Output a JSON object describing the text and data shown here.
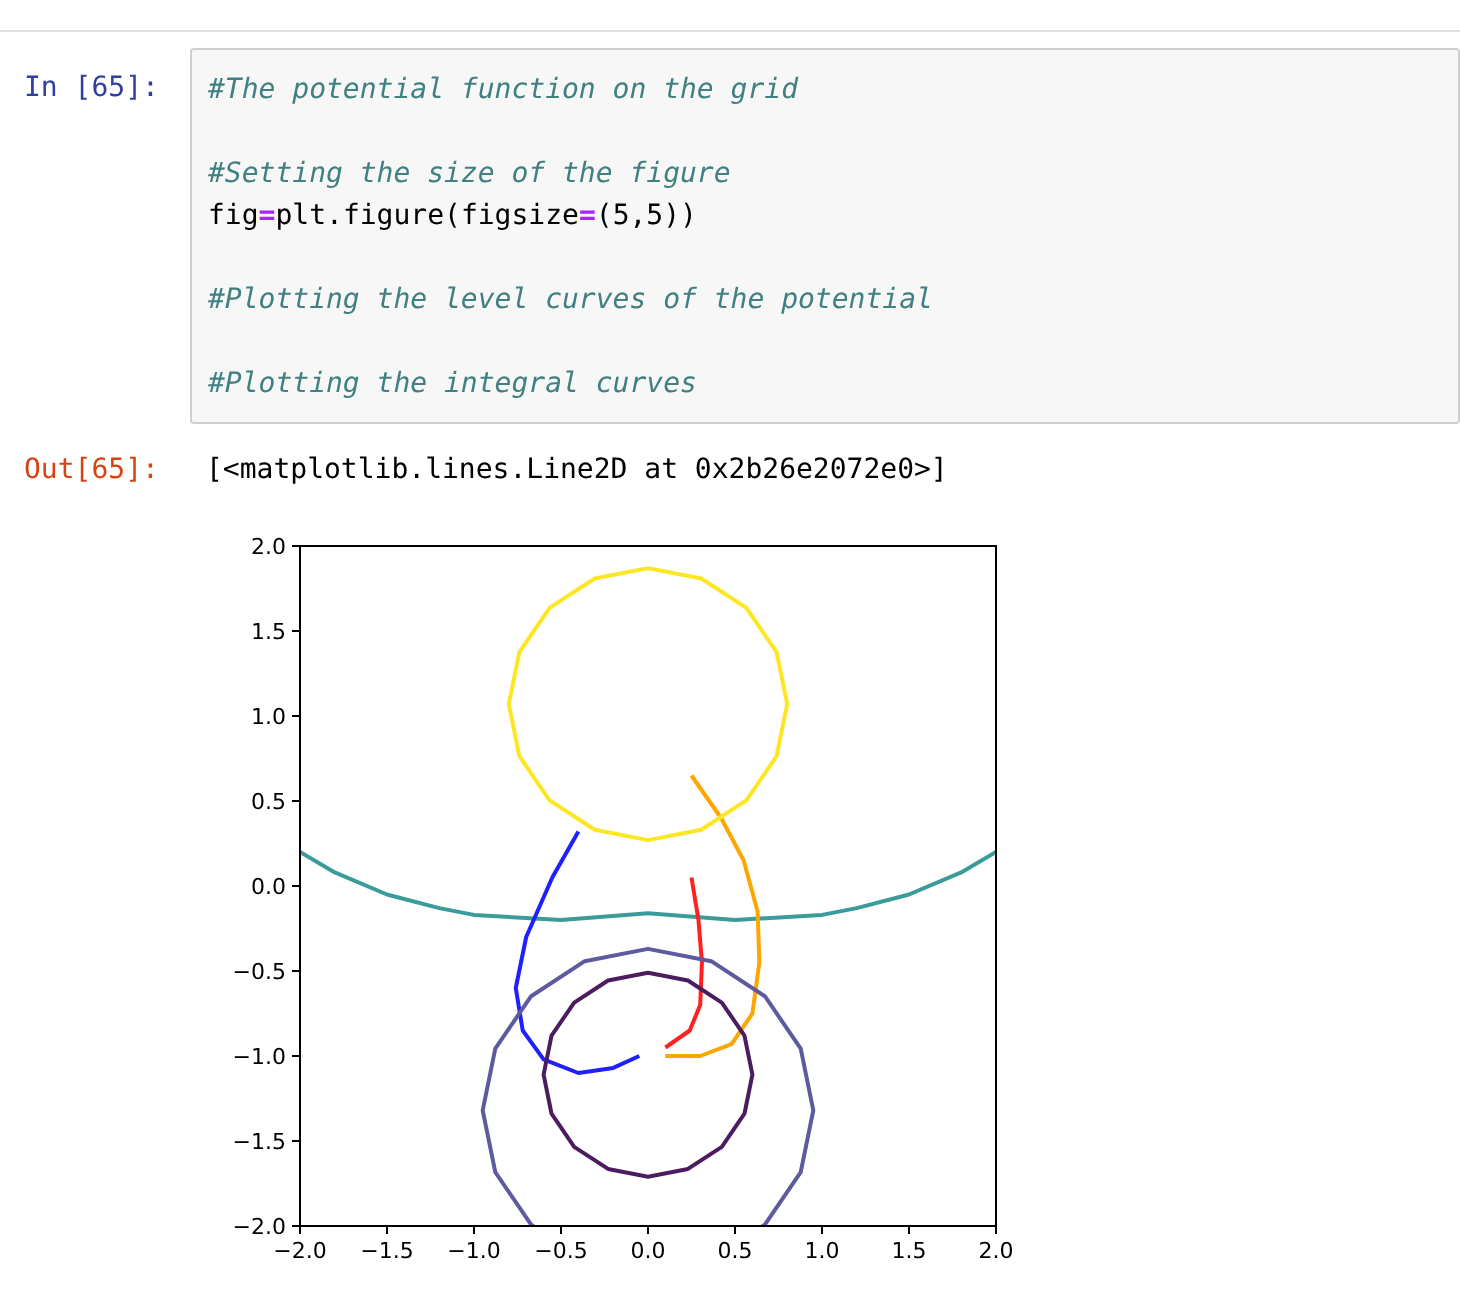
{
  "input_cell": {
    "prompt": "In [65]:",
    "lines": [
      {
        "kind": "comment",
        "text": "#The potential function on the grid"
      },
      {
        "kind": "blank"
      },
      {
        "kind": "comment",
        "text": "#Setting the size of the figure"
      },
      {
        "kind": "code",
        "tokens": [
          {
            "kind": "name",
            "text": "fig"
          },
          {
            "kind": "operator",
            "text": "="
          },
          {
            "kind": "name",
            "text": "plt.figure(figsize"
          },
          {
            "kind": "operator",
            "text": "="
          },
          {
            "kind": "name",
            "text": "(5,5))"
          }
        ]
      },
      {
        "kind": "blank"
      },
      {
        "kind": "comment",
        "text": "#Plotting the level curves of the potential"
      },
      {
        "kind": "blank"
      },
      {
        "kind": "comment",
        "text": "#Plotting the integral curves"
      }
    ]
  },
  "output_cell": {
    "prompt": "Out[65]:",
    "text": "[<matplotlib.lines.Line2D at 0x2b26e2072e0>]",
    "chart_data": {
      "type": "line",
      "xlim": [
        -2,
        2
      ],
      "ylim": [
        -2,
        2
      ],
      "xticks": [
        {
          "value": -2,
          "label": "−2.0"
        },
        {
          "value": -1.5,
          "label": "−1.5"
        },
        {
          "value": -1,
          "label": "−1.0"
        },
        {
          "value": -0.5,
          "label": "−0.5"
        },
        {
          "value": 0,
          "label": "0.0"
        },
        {
          "value": 0.5,
          "label": "0.5"
        },
        {
          "value": 1,
          "label": "1.0"
        },
        {
          "value": 1.5,
          "label": "1.5"
        },
        {
          "value": 2,
          "label": "2.0"
        }
      ],
      "yticks": [
        {
          "value": -2,
          "label": "−2.0"
        },
        {
          "value": -1.5,
          "label": "−1.5"
        },
        {
          "value": -1,
          "label": "−1.0"
        },
        {
          "value": -0.5,
          "label": "−0.5"
        },
        {
          "value": 0,
          "label": "0.0"
        },
        {
          "value": 0.5,
          "label": "0.5"
        },
        {
          "value": 1,
          "label": "1.0"
        },
        {
          "value": 1.5,
          "label": "1.5"
        },
        {
          "value": 2,
          "label": "2.0"
        }
      ],
      "series": [
        {
          "color": "#3b9b9b",
          "x": [
            -2,
            -1.8,
            -1.5,
            -1.2,
            -1,
            -0.5,
            0,
            0.5,
            1,
            1.2,
            1.5,
            1.8,
            2
          ],
          "values": [
            0.2,
            0.08,
            -0.05,
            -0.13,
            -0.17,
            -0.2,
            -0.16,
            -0.2,
            -0.17,
            -0.13,
            -0.05,
            0.08,
            0.2
          ]
        },
        {
          "color": "#2020ff",
          "x": [
            -0.4,
            -0.55,
            -0.7,
            -0.76,
            -0.72,
            -0.6,
            -0.4,
            -0.2,
            -0.05
          ],
          "values": [
            0.32,
            0.05,
            -0.3,
            -0.6,
            -0.85,
            -1.02,
            -1.1,
            -1.07,
            -1.0
          ]
        },
        {
          "color": "#ffa500",
          "x": [
            0.25,
            0.42,
            0.55,
            0.63,
            0.64,
            0.6,
            0.48,
            0.3,
            0.1
          ],
          "values": [
            0.65,
            0.4,
            0.15,
            -0.15,
            -0.45,
            -0.75,
            -0.93,
            -1.0,
            -1.0
          ]
        },
        {
          "color": "#ff2020",
          "x": [
            0.25,
            0.29,
            0.31,
            0.3,
            0.24,
            0.1
          ],
          "values": [
            0.05,
            -0.2,
            -0.45,
            -0.7,
            -0.85,
            -0.95
          ]
        }
      ]
    }
  }
}
